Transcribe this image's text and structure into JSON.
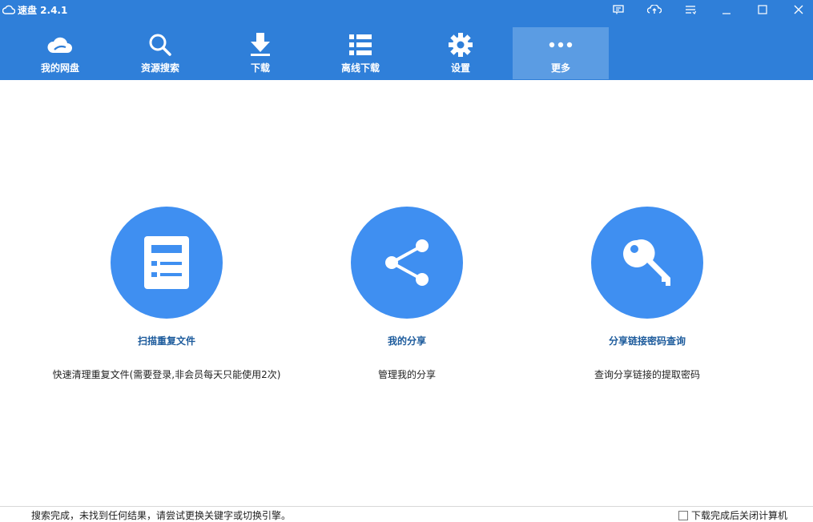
{
  "app": {
    "title": "速盘 2.4.1"
  },
  "window_controls": [
    {
      "name": "feedback-icon"
    },
    {
      "name": "skin-icon"
    },
    {
      "name": "menu-icon"
    },
    {
      "name": "minimize-icon"
    },
    {
      "name": "maximize-icon"
    },
    {
      "name": "close-icon"
    }
  ],
  "tabs": [
    {
      "label": "我的网盘",
      "icon": "cloud-icon"
    },
    {
      "label": "资源搜索",
      "icon": "search-icon"
    },
    {
      "label": "下载",
      "icon": "download-icon"
    },
    {
      "label": "离线下载",
      "icon": "list-icon"
    },
    {
      "label": "设置",
      "icon": "gear-icon"
    },
    {
      "label": "更多",
      "icon": "more-icon",
      "active": true
    }
  ],
  "features": [
    {
      "title": "扫描重复文件",
      "desc": "快速清理重复文件(需要登录,非会员每天只能使用2次)",
      "icon": "document-list-icon"
    },
    {
      "title": "我的分享",
      "desc": "管理我的分享",
      "icon": "share-icon"
    },
    {
      "title": "分享链接密码查询",
      "desc": "查询分享链接的提取密码",
      "icon": "key-icon"
    }
  ],
  "status": {
    "message": "搜索完成，未找到任何结果，请尝试更换关键字或切换引擎。",
    "shutdown_label": "下载完成后关闭计算机",
    "shutdown_checked": false
  },
  "colors": {
    "topbar": "#2f7fd9",
    "active_tab": "#5b9ce3",
    "circle": "#3f8ff1",
    "feature_title": "#1d5b9c"
  }
}
